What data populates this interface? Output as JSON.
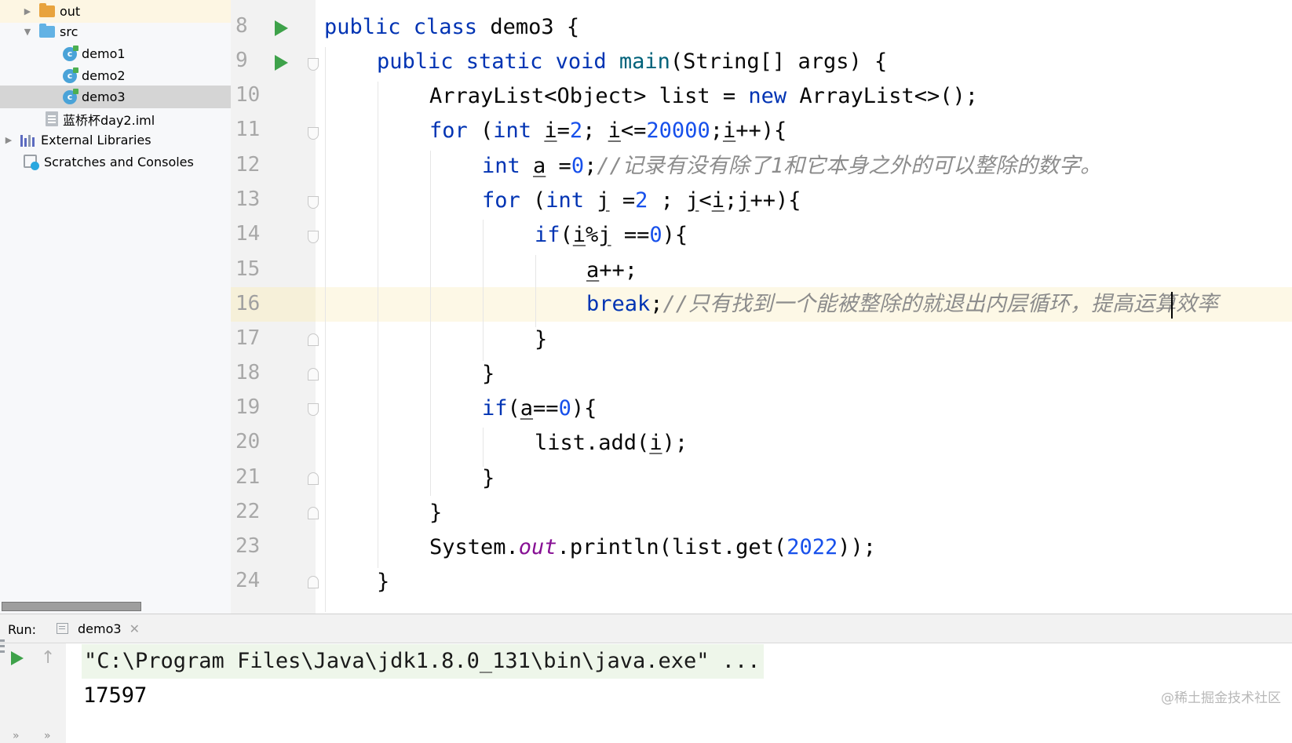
{
  "project_tree": {
    "items": [
      {
        "label": "out",
        "icon": "folder-icon"
      },
      {
        "label": "src",
        "icon": "source-folder-icon"
      },
      {
        "label": "demo1",
        "icon": "java-class-icon"
      },
      {
        "label": "demo2",
        "icon": "java-class-icon"
      },
      {
        "label": "demo3",
        "icon": "java-class-icon",
        "selected": true
      },
      {
        "label": "蓝桥杯day2.iml",
        "icon": "module-file-icon"
      },
      {
        "label": "External Libraries",
        "icon": "libraries-icon"
      },
      {
        "label": "Scratches and Consoles",
        "icon": "scratches-icon"
      }
    ]
  },
  "editor": {
    "line_numbers": [
      "8",
      "9",
      "10",
      "11",
      "12",
      "13",
      "14",
      "15",
      "16",
      "17",
      "18",
      "19",
      "20",
      "21",
      "22",
      "23",
      "24"
    ],
    "current_line": "16",
    "comments": {
      "line12": "//记录有没有除了1和它本身之外的可以整除的数字。",
      "line16": "//只有找到一个能被整除的就退出内层循环，提高运算效率"
    },
    "numbers": {
      "two": "2",
      "limit": "20000",
      "zero": "0",
      "index": "2022"
    }
  },
  "run_panel": {
    "label": "Run:",
    "tab_label": "demo3",
    "console_lines": [
      "\"C:\\Program Files\\Java\\jdk1.8.0_131\\bin\\java.exe\" ...",
      "17597"
    ]
  },
  "watermark": "@稀土掘金技术社区",
  "colors": {
    "keyword": "#0033b3",
    "number": "#1750eb",
    "comment": "#8c8c8c",
    "static_field": "#871094",
    "run_green": "#3ea24a"
  }
}
